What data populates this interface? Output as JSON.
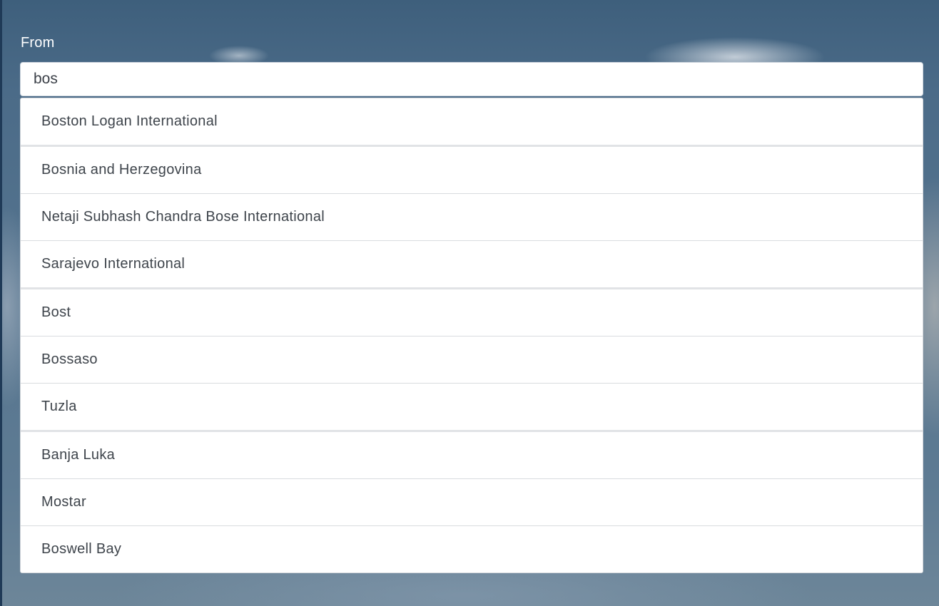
{
  "form": {
    "from_label": "From",
    "search_value": "bos"
  },
  "suggestions": [
    "Boston Logan International",
    "Bosnia and Herzegovina",
    "Netaji Subhash Chandra Bose International",
    "Sarajevo International",
    "Bost",
    "Bossaso",
    "Tuzla",
    "Banja Luka",
    "Mostar",
    "Boswell Bay"
  ]
}
